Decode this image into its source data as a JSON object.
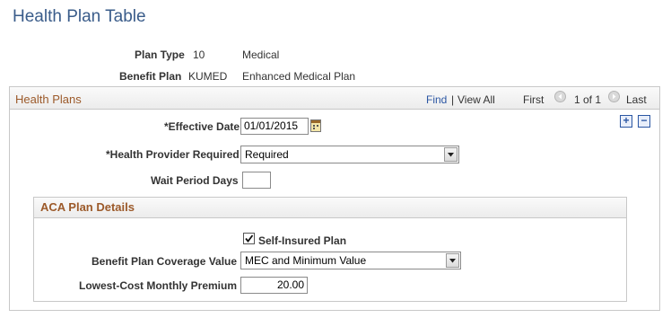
{
  "page": {
    "title": "Health Plan Table"
  },
  "header": {
    "plan_type_label": "Plan Type",
    "plan_type_code": "10",
    "plan_type_desc": "Medical",
    "benefit_plan_label": "Benefit Plan",
    "benefit_plan_code": "KUMED",
    "benefit_plan_desc": "Enhanced Medical Plan"
  },
  "health_plans": {
    "title": "Health Plans",
    "find": "Find",
    "separator": "|",
    "view_all": "View All",
    "first": "First",
    "page_indicator": "1 of 1",
    "last": "Last",
    "add_row": "+",
    "delete_row": "−",
    "effective_date_label": "*Effective Date",
    "effective_date_value": "01/01/2015",
    "provider_required_label": "*Health Provider Required",
    "provider_required_value": "Required",
    "wait_period_label": "Wait Period Days",
    "wait_period_value": ""
  },
  "aca": {
    "title": "ACA Plan Details",
    "self_insured_label": "Self-Insured Plan",
    "self_insured_checked": true,
    "coverage_label": "Benefit Plan Coverage Value",
    "coverage_value": "MEC and Minimum Value",
    "premium_label": "Lowest-Cost Monthly Premium",
    "premium_value": "20.00"
  },
  "colors": {
    "title": "#3a5c8a",
    "section": "#9c5a2a",
    "link": "#2b56a3"
  }
}
